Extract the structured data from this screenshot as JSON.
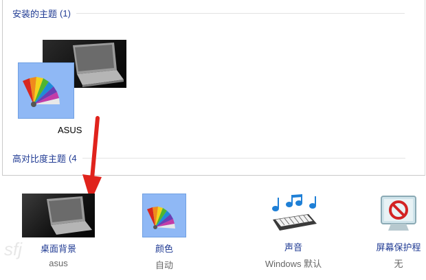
{
  "installed_themes": {
    "header": "安装的主题",
    "count": "(1)",
    "items": [
      {
        "label": "ASUS"
      }
    ]
  },
  "high_contrast_themes": {
    "header": "高对比度主题",
    "count": "(4"
  },
  "bottom_bar": [
    {
      "title": "桌面背景",
      "subtitle": "asus",
      "icon": "desktop-background-icon"
    },
    {
      "title": "颜色",
      "subtitle": "自动",
      "icon": "color-palette-icon"
    },
    {
      "title": "声音",
      "subtitle": "Windows 默认",
      "icon": "sound-keyboard-icon"
    },
    {
      "title": "屏幕保护程",
      "subtitle": "无",
      "icon": "screensaver-icon"
    }
  ],
  "watermark": "sfj",
  "colors": {
    "link_blue": "#1f3a93",
    "tile_blue": "#8fb8f5",
    "arrow_red": "#e0231c"
  }
}
